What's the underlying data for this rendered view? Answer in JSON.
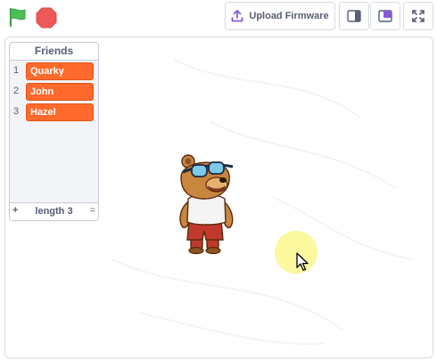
{
  "toolbar": {
    "upload_label": "Upload Firmware",
    "icons": {
      "flag": "green-flag-icon",
      "stop": "stop-sign-icon",
      "upload": "upload-icon",
      "small_stage": "small-stage-icon",
      "large_stage": "large-stage-icon",
      "fullscreen": "fullscreen-icon"
    }
  },
  "list_monitor": {
    "title": "Friends",
    "items": [
      {
        "index": "1",
        "value": "Quarky"
      },
      {
        "index": "2",
        "value": "John"
      },
      {
        "index": "3",
        "value": "Hazel"
      }
    ],
    "add_symbol": "+",
    "length_label": "length 3",
    "resize_symbol": "="
  },
  "sprite": {
    "name": "bear-sprite"
  },
  "colors": {
    "flag_green": "#4cbf56",
    "stop_red": "#ec5959",
    "item_orange": "#ff6a2c",
    "accent_blue": "#855cd6",
    "text_gray": "#575e75"
  }
}
